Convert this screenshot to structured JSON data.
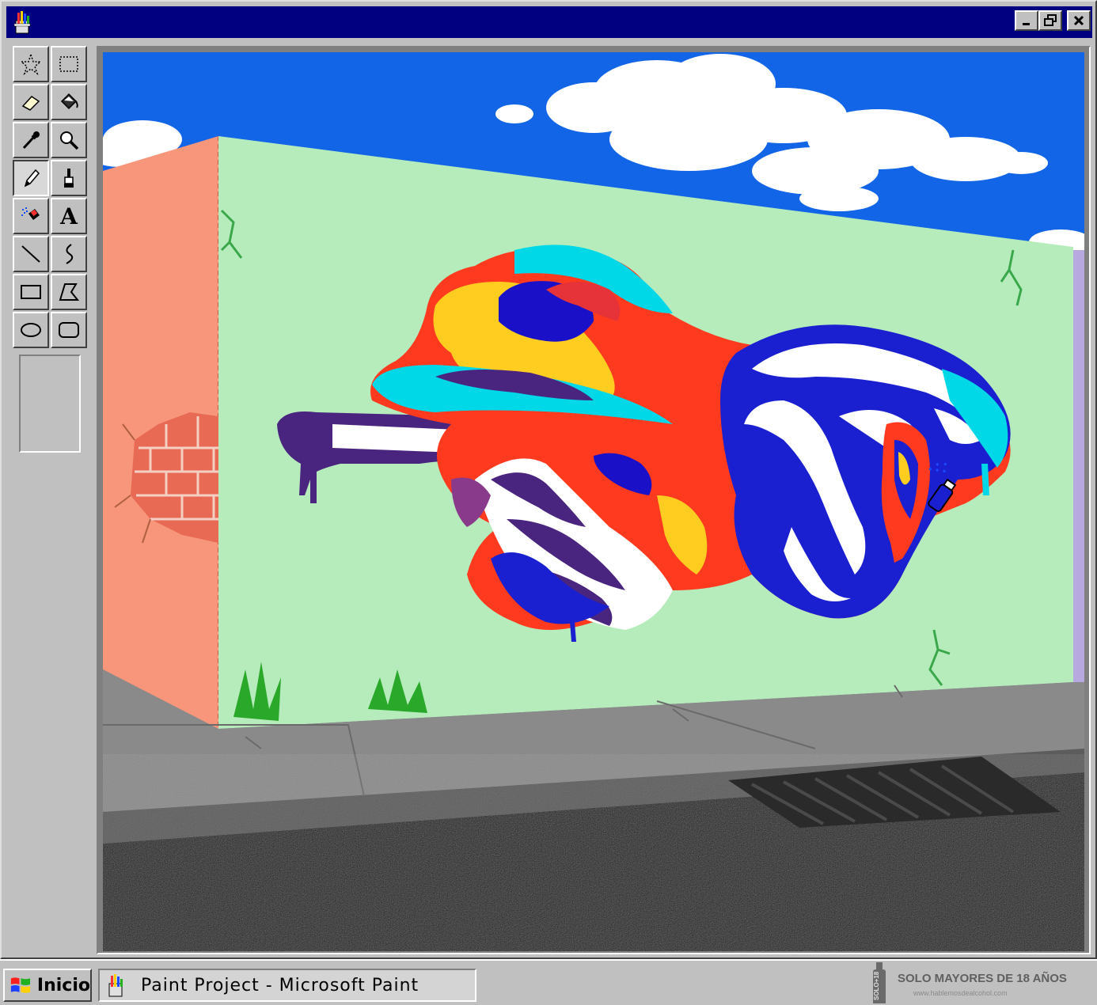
{
  "window": {
    "title": "",
    "controls": [
      "minimize",
      "restore",
      "close"
    ]
  },
  "toolbox": {
    "tools": [
      {
        "name": "free-form-select",
        "icon": "star-select-icon"
      },
      {
        "name": "select",
        "icon": "rect-select-icon"
      },
      {
        "name": "eraser",
        "icon": "eraser-icon"
      },
      {
        "name": "fill",
        "icon": "fill-bucket-icon"
      },
      {
        "name": "pick-color",
        "icon": "eyedropper-icon"
      },
      {
        "name": "magnifier",
        "icon": "magnifier-icon"
      },
      {
        "name": "pencil",
        "icon": "pencil-icon",
        "active": true
      },
      {
        "name": "brush",
        "icon": "brush-icon"
      },
      {
        "name": "airbrush",
        "icon": "airbrush-icon"
      },
      {
        "name": "text",
        "icon": "text-icon",
        "glyph": "A"
      },
      {
        "name": "line",
        "icon": "line-icon"
      },
      {
        "name": "curve",
        "icon": "curve-icon"
      },
      {
        "name": "rectangle",
        "icon": "rectangle-icon"
      },
      {
        "name": "polygon",
        "icon": "polygon-icon"
      },
      {
        "name": "ellipse",
        "icon": "ellipse-icon"
      },
      {
        "name": "rounded-rectangle",
        "icon": "rounded-rectangle-icon"
      }
    ]
  },
  "canvas": {
    "artwork": "graffiti-mural-illustration",
    "colors": {
      "sky": "#1265e6",
      "wall": "#b6ecbc",
      "side_wall": "#f7967a",
      "sidewalk": "#8a8a8a",
      "road": "#0c0c0c"
    }
  },
  "taskbar": {
    "start_label": "Inicio",
    "task_label": "Paint Project - Microsoft Paint",
    "ad": {
      "title": "SOLO MAYORES DE 18 AÑOS",
      "url": "www.hablemosdealcohol.com",
      "bottle_text": "SOLO+18"
    }
  }
}
